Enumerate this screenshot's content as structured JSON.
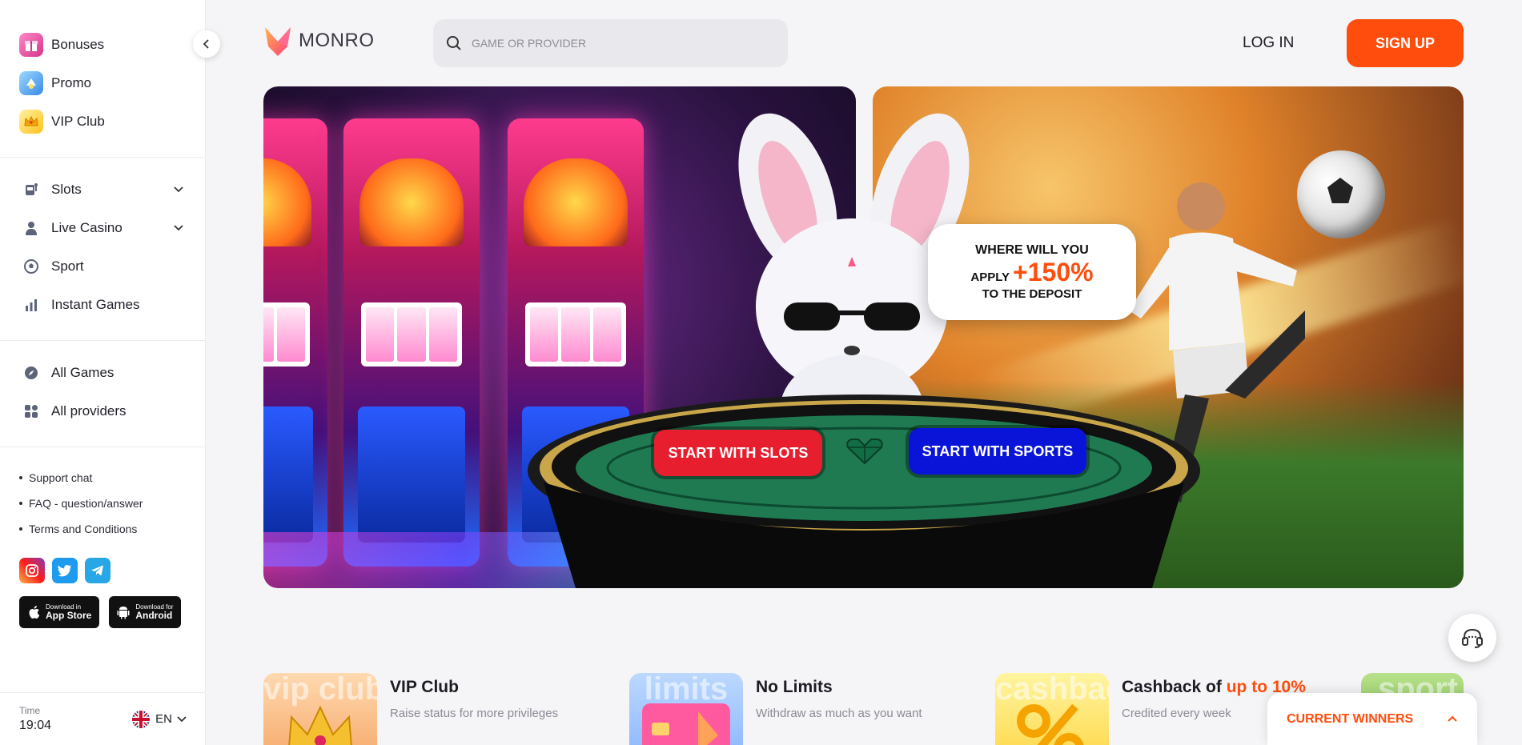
{
  "sidebar": {
    "top_items": [
      {
        "label": "Bonuses",
        "icon": "gift-icon"
      },
      {
        "label": "Promo",
        "icon": "promo-icon"
      },
      {
        "label": "VIP Club",
        "icon": "crown-icon"
      }
    ],
    "category_items": [
      {
        "label": "Slots",
        "icon": "slot-machine-icon",
        "has_dropdown": true
      },
      {
        "label": "Live Casino",
        "icon": "dealer-icon",
        "has_dropdown": true
      },
      {
        "label": "Sport",
        "icon": "soccer-ball-icon",
        "has_dropdown": false
      },
      {
        "label": "Instant Games",
        "icon": "chart-icon",
        "has_dropdown": false
      }
    ],
    "game_items": [
      {
        "label": "All Games",
        "icon": "compass-icon"
      },
      {
        "label": "All providers",
        "icon": "grid-icon"
      }
    ],
    "links": [
      {
        "label": "Support chat"
      },
      {
        "label": "FAQ - question/answer"
      },
      {
        "label": "Terms and Conditions"
      }
    ],
    "socials": [
      "instagram-icon",
      "twitter-icon",
      "telegram-icon"
    ],
    "stores": [
      {
        "small": "Download in",
        "big": "App Store",
        "icon": "apple-icon"
      },
      {
        "small": "Download for",
        "big": "Android",
        "icon": "android-icon"
      }
    ],
    "time_label": "Time",
    "time_value": "19:04",
    "language": "EN"
  },
  "header": {
    "logo_text": "MONRO",
    "search_placeholder": "GAME OR PROVIDER",
    "login_label": "LOG IN",
    "signup_label": "SIGN UP"
  },
  "banner": {
    "bubble_line1": "WHERE WILL YOU",
    "bubble_apply": "APPLY",
    "bubble_percent": "+150%",
    "bubble_line3": "TO THE DEPOSIT",
    "cta_slots": "START WITH SLOTS",
    "cta_sports": "START WITH SPORTS"
  },
  "features": [
    {
      "title": "VIP Club",
      "highlight": "",
      "subtitle": "Raise status for more privileges",
      "ghost": "vip club"
    },
    {
      "title": "No Limits",
      "highlight": "",
      "subtitle": "Withdraw as much as you want",
      "ghost": "limits"
    },
    {
      "title": "Cashback of ",
      "highlight": "up to 10%",
      "subtitle": "Credited every week",
      "ghost": "cashback"
    },
    {
      "title": "",
      "highlight": "",
      "subtitle": "",
      "ghost": "sport"
    }
  ],
  "winners_label": "CURRENT WINNERS",
  "colors": {
    "accent": "#ff4d0d",
    "cta_slots": "#e61e2e",
    "cta_sports": "#0a14d8"
  }
}
